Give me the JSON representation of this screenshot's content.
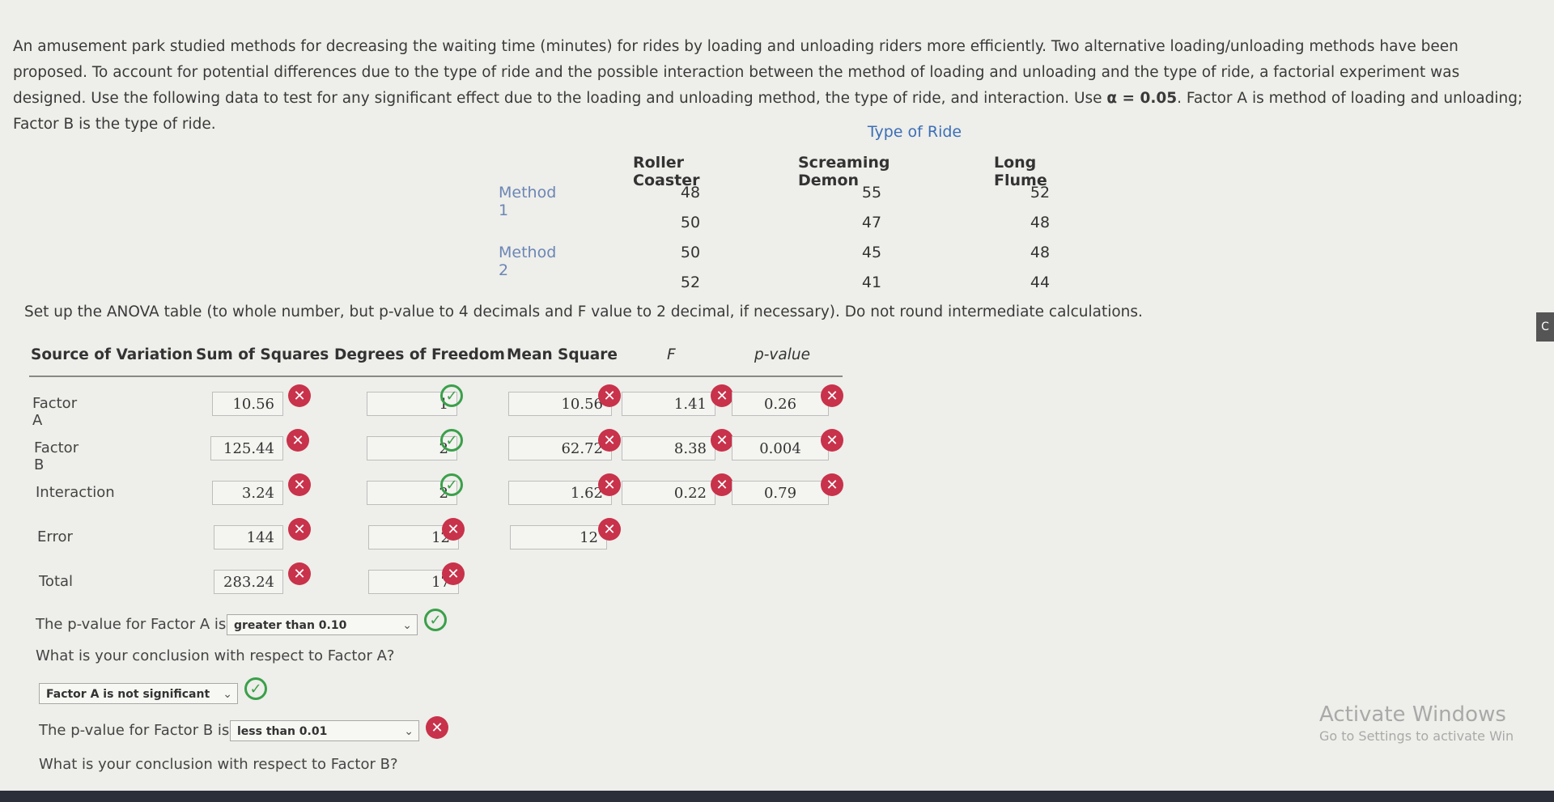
{
  "problem": {
    "text_part1": "An amusement park studied methods for decreasing the waiting time (minutes) for rides by loading and unloading riders more efficiently. Two alternative loading/unloading methods have been proposed. To account for potential differences due to the type of ride and the possible interaction between the method of loading and unloading and the type of ride, a factorial experiment was designed. Use the following data to test for any significant effect due to the loading and unloading method, the type of ride, and interaction. Use ",
    "alpha": "α = 0.05",
    "text_part2": ". Factor A is method of loading and unloading; Factor B is the type of ride."
  },
  "ride_table": {
    "caption": "Type of Ride",
    "headers": [
      "Roller Coaster",
      "Screaming Demon",
      "Long Flume"
    ],
    "method1_label": "Method 1",
    "method2_label": "Method 2",
    "rows": [
      [
        "48",
        "55",
        "52"
      ],
      [
        "50",
        "47",
        "48"
      ],
      [
        "50",
        "45",
        "48"
      ],
      [
        "52",
        "41",
        "44"
      ]
    ]
  },
  "setup_text": "Set up the ANOVA table (to whole number, but p-value to 4 decimals and F value to 2 decimal, if necessary). Do not round intermediate calculations.",
  "anova": {
    "headers": [
      "Source of Variation",
      "Sum of Squares",
      "Degrees of Freedom",
      "Mean Square",
      "F",
      "p-value"
    ],
    "rows": [
      {
        "label": "Factor A",
        "ss": "10.56",
        "df": "1",
        "ms": "10.56",
        "f": "1.41",
        "p": "0.26"
      },
      {
        "label": "Factor B",
        "ss": "125.44",
        "df": "2",
        "ms": "62.72",
        "f": "8.38",
        "p": "0.004"
      },
      {
        "label": "Interaction",
        "ss": "3.24",
        "df": "2",
        "ms": "1.62",
        "f": "0.22",
        "p": "0.79"
      },
      {
        "label": "Error",
        "ss": "144",
        "df": "12",
        "ms": "12"
      },
      {
        "label": "Total",
        "ss": "283.24",
        "df": "17"
      }
    ]
  },
  "questions": {
    "q1_prefix": "The p-value for Factor A is",
    "q1_value": "greater than 0.10",
    "q2_text": "What is your conclusion with respect to Factor A?",
    "q2_value": "Factor A is not significant",
    "q3_prefix": "The p-value for Factor B is",
    "q3_value": "less than 0.01",
    "q4_text": "What is your conclusion with respect to Factor B?"
  },
  "watermark": {
    "line1": "Activate Windows",
    "line2": "Go to Settings to activate Win"
  },
  "side_tab": "C",
  "icons": {
    "wrong": "x-circle-icon",
    "correct": "check-circle-icon",
    "dropdown": "chevron-down-icon"
  },
  "colors": {
    "wrong": "#c8324a",
    "correct": "#3aa04a",
    "caption": "#3b6fb6"
  }
}
